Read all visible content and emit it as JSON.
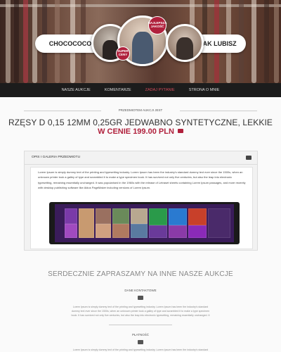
{
  "header": {
    "left_label": "CHOCOCOCO",
    "right_label": "TAK JAK LUBISZ",
    "badge_top": "NAJLEPSZA JAKOŚĆ",
    "badge_small": "SUPER CENY"
  },
  "nav": {
    "items": [
      {
        "label": "NASZE AUKCJE"
      },
      {
        "label": "KOMENTARZE"
      },
      {
        "label": "ZADAJ PYTANIE"
      },
      {
        "label": "STRONA O MNIE"
      }
    ],
    "active_index": 2
  },
  "product": {
    "subject_label": "PRZEDMIOTEM AUKCJI JEST",
    "title": "RZĘSY D 0,15 12MM 0,25GR JEDWABNO SYNTETYCZNE, LEKKIE",
    "price": "W CENIE 199.00 PLN"
  },
  "description": {
    "heading": "OPIS I GALERIA PRZEDMIOTU",
    "text": "Lorem Ipsum is simply dummy text of the printing and typesetting industry. Lorem Ipsum has been the industry's standard dummy text ever since the 1500s, when an unknown printer took a galley of type and scrambled it to make a type specimen book. It has survived not only five centuries, but also the leap into electronic typesetting, remaining essentially unchanged. It was popularised in the 1960s with the release of Letraset sheets containing Lorem Ipsum passages, and more recently with desktop publishing software like Aldus PageMaker including versions of Lorem Ipsum."
  },
  "invite": {
    "title": "SERDECZNIE ZAPRASZAMY NA INNE NASZE AUKCJE"
  },
  "sections": [
    {
      "heading": "DANE KONTAKTOWE",
      "text": "Lorem Ipsum is simply dummy text of the printing and typesetting industry. Lorem Ipsum has been the industry's standard dummy text ever since the 1500s, when an unknown printer took a galley of type and scrambled it to make a type specimen book. It has survived not only five centuries, but also the leap into electronic typesetting, remaining essentially unchanged. It"
    },
    {
      "heading": "PŁATNOŚĆ",
      "text": "Lorem Ipsum is simply dummy text of the printing and typesetting industry. Lorem Ipsum has been the industry's standard"
    }
  ],
  "colors": {
    "accent": "#b0203c",
    "nav_bg": "#1c1c1c",
    "nav_active": "#d24b5a"
  },
  "icons": {
    "price_cart": "cart-icon",
    "description": "gallery-icon",
    "contact": "contact-card-icon",
    "payment": "wallet-icon"
  }
}
